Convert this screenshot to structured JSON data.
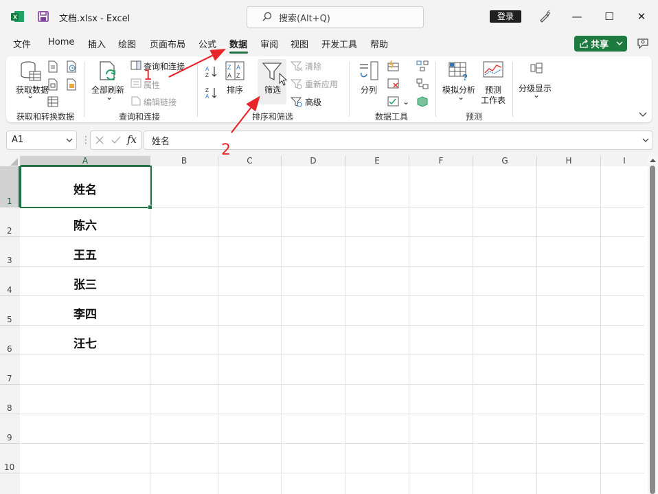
{
  "titlebar": {
    "doc_title": "文档.xlsx  -  Excel",
    "search_placeholder": "搜索(Alt+Q)",
    "login_label": "登录",
    "minimize": "—",
    "maximize": "☐",
    "close": "✕"
  },
  "menu": {
    "items": [
      "文件",
      "Home",
      "插入",
      "绘图",
      "页面布局",
      "公式",
      "数据",
      "审阅",
      "视图",
      "开发工具",
      "帮助"
    ],
    "active": "数据",
    "share_label": "共享"
  },
  "ribbon": {
    "get_data": "获取数据",
    "get_data_arrow": "⌄",
    "refresh_all": "全部刷新",
    "queries_connections": "查询和连接",
    "properties": "属性",
    "edit_links": "编辑链接",
    "sort": "排序",
    "filter": "筛选",
    "clear": "清除",
    "reapply": "重新应用",
    "advanced": "高级",
    "text_to_columns": "分列",
    "what_if": "模拟分析",
    "forecast_sheet_1": "预测",
    "forecast_sheet_2": "工作表",
    "outline": "分级显示",
    "groups": {
      "get_transform": "获取和转换数据",
      "queries": "查询和连接",
      "sort_filter": "排序和筛选",
      "data_tools": "数据工具",
      "forecast": "预测"
    }
  },
  "formula_bar": {
    "name_box": "A1",
    "fx": "fx",
    "content": "姓名"
  },
  "sheet": {
    "columns": [
      "A",
      "B",
      "C",
      "D",
      "E",
      "F",
      "G",
      "H",
      "I"
    ],
    "rows": [
      "1",
      "2",
      "3",
      "4",
      "5",
      "6",
      "7",
      "8",
      "9",
      "10"
    ],
    "cells_a": [
      "姓名",
      "陈六",
      "王五",
      "张三",
      "李四",
      "汪七"
    ]
  },
  "annotations": {
    "step1": "1",
    "step2": "2",
    "color": "#e8262a"
  },
  "colors": {
    "accent": "#217346",
    "share_bg": "#1f7a3f"
  }
}
